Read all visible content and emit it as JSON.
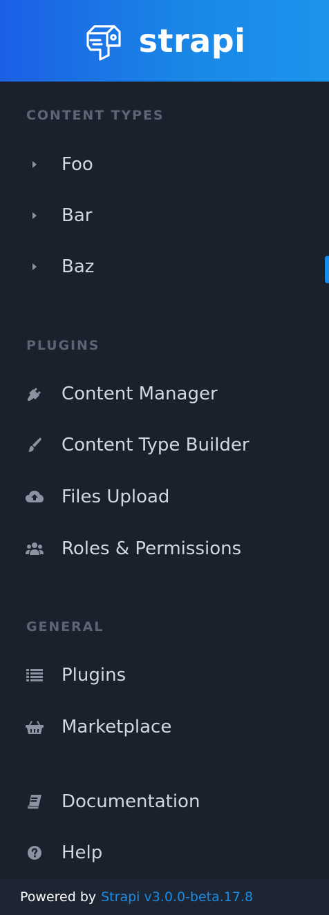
{
  "brand": {
    "name": "strapi",
    "logo_icon": "strapi-logo-icon"
  },
  "sections": {
    "content_types": {
      "title": "CONTENT TYPES",
      "items": [
        {
          "label": "Foo",
          "icon": "caret-right-icon"
        },
        {
          "label": "Bar",
          "icon": "caret-right-icon"
        },
        {
          "label": "Baz",
          "icon": "caret-right-icon"
        }
      ]
    },
    "plugins": {
      "title": "PLUGINS",
      "items": [
        {
          "label": "Content Manager",
          "icon": "plug-icon"
        },
        {
          "label": "Content Type Builder",
          "icon": "paint-brush-icon"
        },
        {
          "label": "Files Upload",
          "icon": "cloud-upload-icon"
        },
        {
          "label": "Roles & Permissions",
          "icon": "users-icon"
        }
      ]
    },
    "general": {
      "title": "GENERAL",
      "items": [
        {
          "label": "Plugins",
          "icon": "list-icon"
        },
        {
          "label": "Marketplace",
          "icon": "basket-icon"
        }
      ]
    },
    "bottom": {
      "items": [
        {
          "label": "Documentation",
          "icon": "book-icon"
        },
        {
          "label": "Help",
          "icon": "question-circle-icon"
        }
      ]
    }
  },
  "footer": {
    "prefix": "Powered by",
    "link_text": "Strapi v3.0.0-beta.17.8"
  },
  "colors": {
    "header_start": "#1c5fe6",
    "header_end": "#1d94ec",
    "sidebar_bg": "#1a202c",
    "section_title": "#5d6574",
    "item_text": "#d2d6de",
    "icon": "#8b93a1",
    "accent": "#1a8ce6"
  }
}
